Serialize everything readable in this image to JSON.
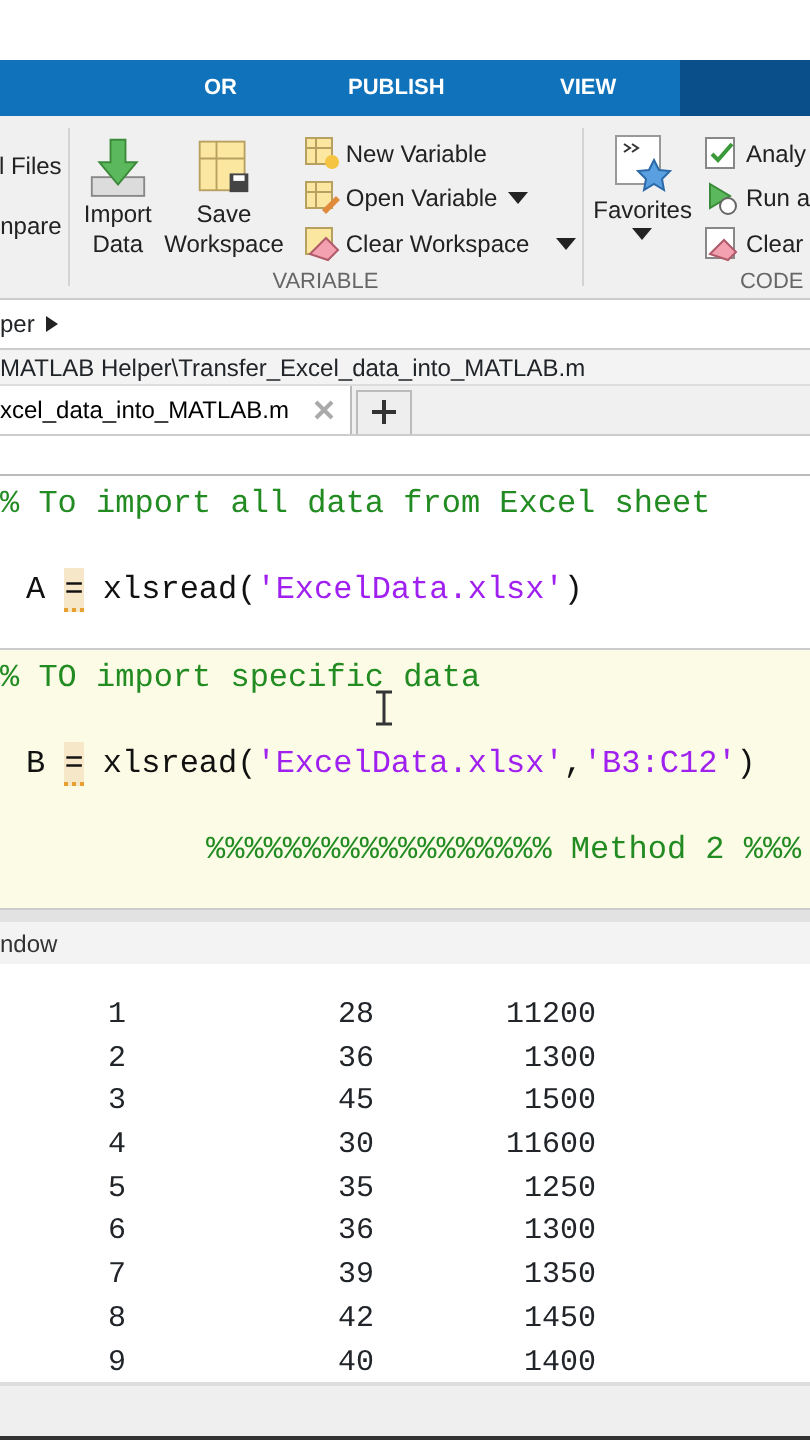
{
  "ribbon_tabs": [
    {
      "label": "OR",
      "selected": false
    },
    {
      "label": "PUBLISH",
      "selected": false
    },
    {
      "label": "VIEW",
      "selected": false
    }
  ],
  "ribbon": {
    "file_items": [
      "l Files",
      "npare"
    ],
    "import_button": "Import\nData",
    "save_button": "Save\nWorkspace",
    "variable_items": [
      {
        "label": "New Variable",
        "kind": "plain"
      },
      {
        "label": "Open Variable",
        "kind": "caret"
      },
      {
        "label": "Clear Workspace",
        "kind": "split"
      }
    ],
    "variable_label": "VARIABLE",
    "favorites_button": "Favorites",
    "code_items": [
      "Analy",
      "Run a",
      "Clear"
    ],
    "code_label": "CODE"
  },
  "address_bar": "per",
  "file_path": "MATLAB Helper\\Transfer_Excel_data_into_MATLAB.m",
  "editor_tabs": [
    {
      "label": "xcel_data_into_MATLAB.m",
      "selected": true
    }
  ],
  "editor_sections": [
    {
      "highlighted": false,
      "lines": [
        [
          {
            "kind": "comment",
            "text": "% To import all data from Excel sheet"
          }
        ],
        [
          {
            "kind": "code",
            "text": "A"
          },
          {
            "kind": "warn",
            "text": "="
          },
          {
            "kind": "code",
            "text": "xlsread("
          },
          {
            "kind": "string",
            "text": "'ExcelData.xlsx'"
          },
          {
            "kind": "code",
            "text": ")"
          }
        ]
      ]
    },
    {
      "highlighted": true,
      "lines": [
        [
          {
            "kind": "comment",
            "text": "% TO import specific data"
          }
        ],
        [
          {
            "kind": "code",
            "text": "B"
          },
          {
            "kind": "warn",
            "text": "="
          },
          {
            "kind": "code",
            "text": "xlsread("
          },
          {
            "kind": "string",
            "text": "'ExcelData.xlsx'"
          },
          {
            "kind": "code",
            "text": ","
          },
          {
            "kind": "string",
            "text": "'B3:C12'"
          },
          {
            "kind": "code",
            "text": ")"
          }
        ],
        [
          {
            "kind": "banner",
            "text": "%%%%%%%%%%%%%%%%%% Method 2 %%%"
          }
        ]
      ]
    }
  ],
  "command_window": {
    "title": "ndow",
    "rows": [
      [
        "1",
        "28",
        "11200"
      ],
      [
        "2",
        "36",
        "1300"
      ],
      [
        "3",
        "45",
        "1500"
      ],
      [
        "4",
        "30",
        "11600"
      ],
      [
        "5",
        "35",
        "1250"
      ],
      [
        "6",
        "36",
        "1300"
      ],
      [
        "7",
        "39",
        "1350"
      ],
      [
        "8",
        "42",
        "1450"
      ],
      [
        "9",
        "40",
        "1400"
      ]
    ]
  }
}
